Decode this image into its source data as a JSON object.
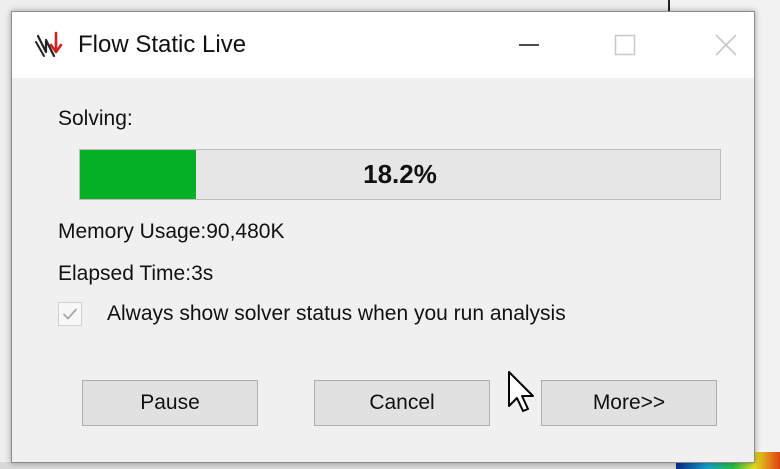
{
  "window": {
    "title": "Flow Static Live",
    "app_icon": "flow-solver-icon",
    "controls": [
      "minimize",
      "maximize",
      "close"
    ]
  },
  "status": {
    "solving_label": "Solving:",
    "progress_percent": 18.2,
    "progress_text": "18.2%",
    "memory_usage": "Memory Usage:90,480K",
    "elapsed_time": "Elapsed Time:3s"
  },
  "options": {
    "always_show_label": "Always show solver status when you run analysis",
    "always_show_checked": true
  },
  "buttons": {
    "pause": "Pause",
    "cancel": "Cancel",
    "more": "More>>"
  },
  "colors": {
    "progress_fill": "#06b025",
    "dialog_bg": "#f0f0f0",
    "titlebar_bg": "#ffffff"
  }
}
